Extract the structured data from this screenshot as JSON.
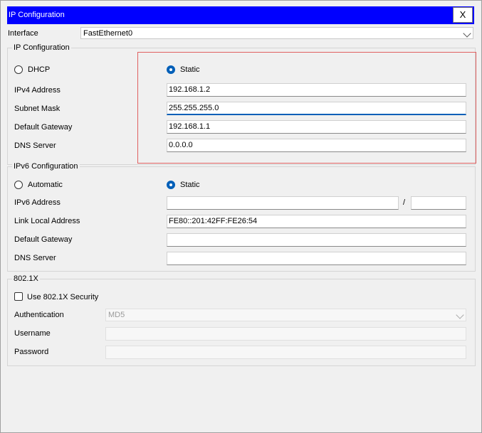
{
  "window": {
    "title": "IP Configuration",
    "close_label": "X"
  },
  "interface": {
    "label": "Interface",
    "value": "FastEthernet0"
  },
  "ipv4": {
    "legend": "IP Configuration",
    "dhcp_label": "DHCP",
    "static_label": "Static",
    "mode": "static",
    "address_label": "IPv4 Address",
    "address_value": "192.168.1.2",
    "mask_label": "Subnet Mask",
    "mask_value": "255.255.255.0",
    "gateway_label": "Default Gateway",
    "gateway_value": "192.168.1.1",
    "dns_label": "DNS Server",
    "dns_value": "0.0.0.0"
  },
  "ipv6": {
    "legend": "IPv6 Configuration",
    "automatic_label": "Automatic",
    "static_label": "Static",
    "mode": "static",
    "address_label": "IPv6 Address",
    "address_value": "",
    "prefix_separator": "/",
    "prefix_value": "",
    "link_local_label": "Link Local Address",
    "link_local_value": "FE80::201:42FF:FE26:54",
    "gateway_label": "Default Gateway",
    "gateway_value": "",
    "dns_label": "DNS Server",
    "dns_value": ""
  },
  "dot1x": {
    "legend": "802.1X",
    "use_security_label": "Use 802.1X Security",
    "use_security_checked": false,
    "auth_label": "Authentication",
    "auth_value": "MD5",
    "username_label": "Username",
    "username_value": "",
    "password_label": "Password",
    "password_value": ""
  },
  "colors": {
    "titlebar": "#0000ff",
    "accent": "#005fb8",
    "highlight_box": "#e06060"
  }
}
